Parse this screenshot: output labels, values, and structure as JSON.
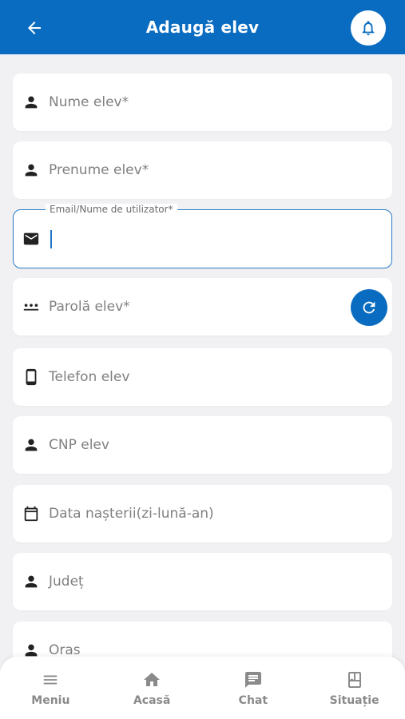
{
  "header": {
    "title": "Adaugă elev",
    "back_icon": "arrow-back-icon",
    "bell_icon": "bell-icon"
  },
  "form": {
    "nume_placeholder": "Nume elev*",
    "prenume_placeholder": "Prenume elev*",
    "email_label": "Email/Nume de utilizator*",
    "email_value": "",
    "parola_placeholder": "Parolă elev*",
    "telefon_placeholder": "Telefon elev",
    "cnp_placeholder": "CNP elev",
    "data_placeholder": "Data nașterii(zi-lună-an)",
    "judet_placeholder": "Județ",
    "oras_placeholder": "Oras"
  },
  "nav": {
    "meniu": "Meniu",
    "acasa": "Acasă",
    "chat": "Chat",
    "situatie": "Situație"
  },
  "colors": {
    "primary": "#0a6cc0",
    "background": "#f1f1f3",
    "focus_border": "#2a7cc7"
  }
}
